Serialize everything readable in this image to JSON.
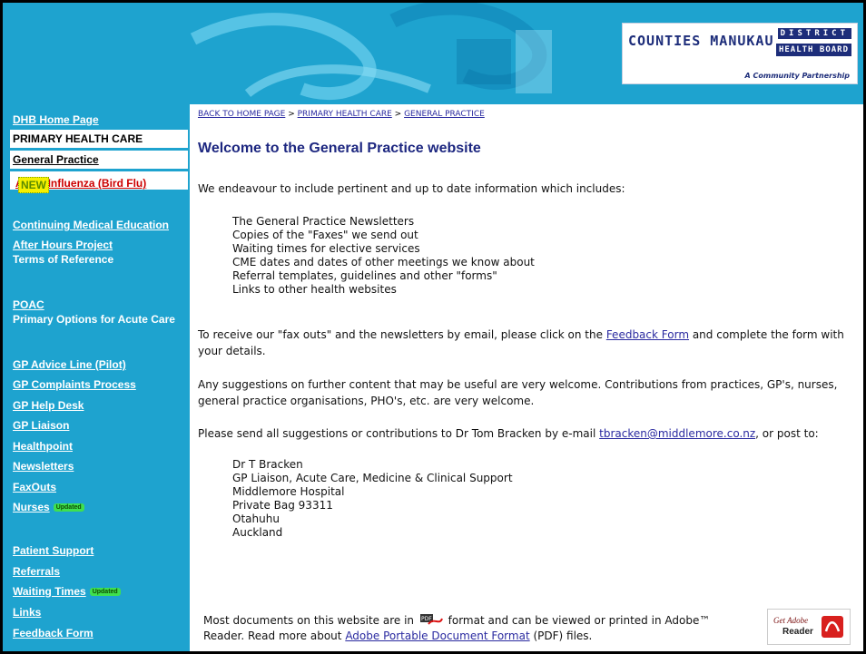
{
  "header": {
    "logo_main": "COUNTIES MANUKAU",
    "logo_district": "DISTRICT",
    "logo_health_board": "HEALTH BOARD",
    "logo_tagline": "A Community Partnership"
  },
  "sidebar": {
    "dhb_home": "DHB Home Page",
    "primary_health_care": "PRIMARY HEALTH CARE",
    "general_practice": "General Practice",
    "avian_influenza": "Avian Influenza (Bird Flu)",
    "new_badge": "NEW",
    "cme": "Continuing Medical Education",
    "after_hours": "After Hours Project",
    "terms": "Terms of Reference",
    "poac": "POAC",
    "poac_full": "Primary Options for Acute Care",
    "gp_advice": "GP Advice Line (Pilot)",
    "gp_complaints": "GP Complaints Process",
    "gp_help": "GP Help Desk",
    "gp_liaison": "GP Liaison",
    "healthpoint": "Healthpoint",
    "newsletters": "Newsletters",
    "faxouts": "FaxOuts",
    "nurses": "Nurses",
    "updated_badge": "Updated",
    "patient_support": "Patient Support",
    "referrals": "Referrals",
    "waiting_times": "Waiting Times",
    "links": "Links",
    "feedback_form": "Feedback Form"
  },
  "main": {
    "crumb_home": "BACK TO HOME PAGE",
    "crumb_sep": " > ",
    "crumb_phc": "PRIMARY HEALTH CARE",
    "crumb_gp": "GENERAL PRACTICE",
    "title": "Welcome to the General Practice website",
    "intro": "We endeavour to include pertinent and up to date information which includes:",
    "list": [
      "The General Practice Newsletters",
      "Copies of the \"Faxes\" we send out",
      "Waiting times for elective services",
      "CME dates and dates of other meetings we know about",
      "Referral templates, guidelines and other \"forms\"",
      "Links to other health websites"
    ],
    "fax_pre": "To receive our \"fax outs\" and the newsletters by email, please click on the ",
    "fax_link": "Feedback Form",
    "fax_post": " and complete the form with your details.",
    "suggest": "Any suggestions on further content that may be useful are very welcome.   Contributions from practices, GP's, nurses, general practice organisations, PHO's, etc. are very welcome.",
    "send_pre": "Please send all suggestions or contributions to Dr Tom Bracken by e-mail ",
    "send_email": "tbracken@middlemore.co.nz",
    "send_post": ", or post to:",
    "address": [
      "Dr T Bracken",
      "GP Liaison, Acute Care, Medicine & Clinical Support",
      "Middlemore Hospital",
      "Private Bag 93311",
      "Otahuhu",
      "Auckland"
    ],
    "footer_pre": "Most documents on this website are in ",
    "footer_mid": " format and can be viewed or printed in Adobe™ Reader.  Read more about ",
    "footer_link": "Adobe Portable Document Format",
    "footer_post": " (PDF) files.",
    "pdf_icon_text": "PDF",
    "adobe_get": "Get Adobe",
    "adobe_reader": "Reader"
  }
}
